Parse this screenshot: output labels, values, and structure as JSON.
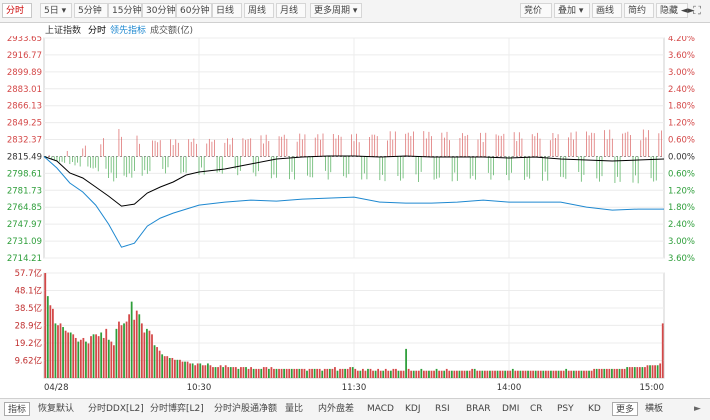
{
  "toolbar": {
    "left": [
      {
        "label": "分时",
        "active": true
      },
      {
        "label": "5日",
        "dropdown": true
      },
      {
        "label": "5分钟"
      },
      {
        "label": "15分钟"
      },
      {
        "label": "30分钟"
      },
      {
        "label": "60分钟"
      },
      {
        "label": "日线"
      },
      {
        "label": "周线"
      },
      {
        "label": "月线"
      },
      {
        "label": "更多周期",
        "dropdown": true
      }
    ],
    "right": [
      {
        "label": "竞价"
      },
      {
        "label": "叠加",
        "dropdown": true
      },
      {
        "label": "画线"
      },
      {
        "label": "简约"
      },
      {
        "label": "隐藏",
        "arrow": "◄►"
      }
    ],
    "expand_icon": "expand-icon"
  },
  "subheader": {
    "index_name": "上证指数",
    "mode": "分时",
    "leading": "领先指标",
    "volume_label": "成交额(亿)"
  },
  "bottombar": {
    "items": [
      "指标",
      "恢复默认",
      "分时DDX[L2]",
      "分时博弈[L2]",
      "分时沪股通净额",
      "量比",
      "内外盘差",
      "MACD",
      "KDJ",
      "RSI",
      "BRAR",
      "DMI",
      "CR",
      "PSY",
      "KD",
      "更多",
      "横板"
    ]
  },
  "chart_data": [
    {
      "type": "line",
      "panel": "price",
      "prev_close": 2815.49,
      "ylim": [
        2714.21,
        2933.65
      ],
      "y_ticks": [
        2933.65,
        2916.77,
        2899.89,
        2883.01,
        2866.13,
        2849.25,
        2832.37,
        2815.49,
        2798.61,
        2781.73,
        2764.85,
        2747.97,
        2731.09,
        2714.21
      ],
      "pct_ticks": [
        "4.20%",
        "3.60%",
        "3.00%",
        "2.40%",
        "1.80%",
        "1.20%",
        "0.60%",
        "0.00%",
        "0.60%",
        "1.20%",
        "1.80%",
        "2.40%",
        "3.00%",
        "3.60%"
      ],
      "x_ticks": [
        "04/28",
        "10:30",
        "11:30",
        "14:00",
        "15:00"
      ],
      "total_minutes": 240,
      "series": [
        {
          "key": "price",
          "color": "#000000",
          "x": [
            0,
            5,
            10,
            15,
            20,
            25,
            30,
            35,
            40,
            45,
            50,
            55,
            60,
            70,
            80,
            90,
            100,
            110,
            120,
            130,
            140,
            150,
            160,
            170,
            180,
            190,
            200,
            210,
            220,
            230,
            240
          ],
          "y": [
            2815.5,
            2811,
            2799,
            2794,
            2785,
            2776,
            2766,
            2768,
            2779,
            2785,
            2790,
            2797,
            2800,
            2803,
            2808,
            2813,
            2815,
            2816,
            2816,
            2815,
            2816,
            2815,
            2815,
            2815,
            2814,
            2815,
            2813,
            2812,
            2811,
            2812,
            2813
          ]
        },
        {
          "key": "leading",
          "color": "#1e88d0",
          "x": [
            0,
            5,
            10,
            15,
            20,
            25,
            30,
            35,
            40,
            45,
            50,
            55,
            60,
            70,
            80,
            90,
            100,
            110,
            120,
            130,
            140,
            150,
            160,
            170,
            180,
            190,
            200,
            210,
            220,
            230,
            240
          ],
          "y": [
            2815.5,
            2804,
            2789,
            2780,
            2767,
            2748,
            2725,
            2729,
            2746,
            2754,
            2759,
            2763,
            2767,
            2770,
            2772,
            2771,
            2773,
            2774,
            2775,
            2770,
            2769,
            2769,
            2770,
            2772,
            2770,
            2770,
            2770,
            2765,
            2762,
            2763,
            2763
          ]
        }
      ]
    },
    {
      "type": "bar",
      "panel": "volume",
      "ylabel": "成交额(亿)",
      "ylim": [
        0,
        57.7
      ],
      "y_ticks": [
        "57.7亿",
        "48.1亿",
        "38.5亿",
        "28.9亿",
        "19.2亿",
        "9.62亿"
      ],
      "values": [
        57.7,
        45,
        40,
        38,
        30,
        29,
        30,
        28,
        26,
        25,
        25,
        24,
        22,
        20,
        21,
        22,
        20,
        19,
        23,
        24,
        24,
        23,
        25,
        22,
        27,
        21,
        20,
        18,
        27,
        31,
        29,
        30,
        31,
        35,
        42,
        32,
        37,
        35,
        30,
        25,
        27,
        26,
        24,
        18,
        17,
        15,
        13,
        12,
        12,
        11,
        11,
        10,
        10,
        10,
        9,
        9,
        9,
        8,
        8,
        7,
        8,
        8,
        7,
        7,
        8,
        7,
        6,
        6,
        6,
        7,
        6,
        7,
        6,
        6,
        6,
        6,
        5,
        6,
        6,
        6,
        5,
        6,
        5,
        5,
        5,
        5,
        6,
        6,
        5,
        6,
        5,
        5,
        5,
        5,
        5,
        5,
        5,
        5,
        5,
        5,
        5,
        5,
        5,
        4,
        5,
        5,
        5,
        5,
        5,
        4,
        5,
        5,
        5,
        5,
        6,
        4,
        5,
        5,
        5,
        5,
        6,
        6,
        5,
        4,
        4,
        5,
        4,
        5,
        5,
        4,
        4,
        5,
        4,
        4,
        5,
        4,
        4,
        5,
        5,
        4,
        4,
        4,
        16,
        5,
        4,
        4,
        4,
        4,
        5,
        4,
        4,
        4,
        4,
        4,
        5,
        4,
        4,
        4,
        5,
        4,
        4,
        4,
        4,
        4,
        4,
        4,
        4,
        4,
        5,
        5,
        4,
        4,
        4,
        4,
        4,
        4,
        4,
        4,
        4,
        4,
        4,
        4,
        4,
        4,
        5,
        4,
        4,
        4,
        4,
        4,
        4,
        4,
        4,
        4,
        4,
        4,
        4,
        4,
        4,
        4,
        4,
        4,
        4,
        4,
        4,
        5,
        4,
        4,
        4,
        4,
        4,
        4,
        4,
        4,
        4,
        4,
        5,
        5,
        5,
        5,
        5,
        5,
        5,
        5,
        5,
        5,
        5,
        5,
        5,
        6,
        6,
        6,
        6,
        6,
        6,
        6,
        6,
        7,
        7,
        7,
        7,
        7,
        8,
        30
      ]
    }
  ],
  "colors": {
    "up": "#d44848",
    "down": "#2e9e3a",
    "price": "#000000",
    "leading": "#1e88d0",
    "grid": "#ececec"
  }
}
